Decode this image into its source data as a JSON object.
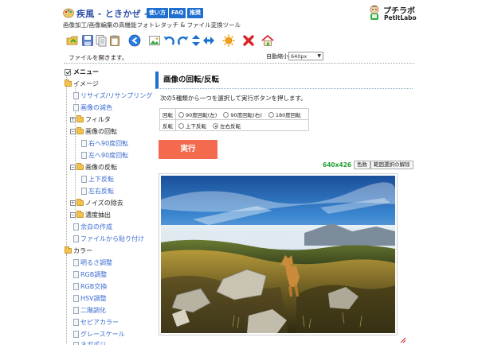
{
  "header": {
    "app_title": "疾風 - ときかぜ -",
    "subtitle": "画像加工/画像編集の高機能フォトレタッチ & ファイル変換ツール",
    "nav": [
      {
        "label": "使い方"
      },
      {
        "label": "FAQ"
      },
      {
        "label": "推奨"
      }
    ],
    "brand_jp": "プチラボ",
    "brand_en": "PetitLabo"
  },
  "toolbar": {
    "icons": [
      "open-icon",
      "save-icon",
      "copy-icon",
      "paste-icon",
      "back-icon",
      "image-icon",
      "undo-icon",
      "redo-icon",
      "swap-vertical-icon",
      "swap-horizontal-icon",
      "settings-sun-icon",
      "clear-icon",
      "home-icon"
    ]
  },
  "status": {
    "text": "ファイルを開きます。",
    "zoom_label": "自動縮小",
    "zoom_value": "640px"
  },
  "sidebar": {
    "root": "メニュー",
    "items": [
      {
        "label": "イメージ",
        "kind": "folder-open"
      },
      {
        "label": "リサイズ/リサンプリング",
        "kind": "leaf"
      },
      {
        "label": "画像の減色",
        "kind": "leaf"
      },
      {
        "label": "フィルタ",
        "kind": "folder-closed"
      },
      {
        "label": "画像の回転",
        "kind": "folder-open"
      },
      {
        "label": "右へ90度回転",
        "kind": "leaf"
      },
      {
        "label": "左へ90度回転",
        "kind": "leaf"
      },
      {
        "label": "画像の反転",
        "kind": "folder-open"
      },
      {
        "label": "上下反転",
        "kind": "leaf"
      },
      {
        "label": "左右反転",
        "kind": "leaf"
      },
      {
        "label": "ノイズの除去",
        "kind": "folder-closed"
      },
      {
        "label": "濃度抽出",
        "kind": "folder-open"
      },
      {
        "label": "余白の作成",
        "kind": "leaf"
      },
      {
        "label": "ファイルから貼り付け",
        "kind": "leaf"
      },
      {
        "label": "カラー",
        "kind": "folder-open"
      },
      {
        "label": "明るさ調整",
        "kind": "leaf"
      },
      {
        "label": "RGB調整",
        "kind": "leaf"
      },
      {
        "label": "RGB交換",
        "kind": "leaf"
      },
      {
        "label": "HSV調整",
        "kind": "leaf"
      },
      {
        "label": "二階調化",
        "kind": "leaf"
      },
      {
        "label": "セピアカラー",
        "kind": "leaf"
      },
      {
        "label": "グレースケール",
        "kind": "leaf"
      },
      {
        "label": "ネガポジ",
        "kind": "leaf"
      }
    ]
  },
  "main": {
    "title": "画像の回転/反転",
    "instruction": "次の5種類から一つを選択して実行ボタンを押します。",
    "rotate_label": "回転",
    "rotate_options": [
      "90度回転(左)",
      "90度回転(右)",
      "180度回転"
    ],
    "flip_label": "反転",
    "flip_options": [
      "上下反転",
      "左右反転"
    ],
    "selected_flip": "左右反転",
    "run_label": "実行",
    "image_size": "640x426",
    "color_button": "色数",
    "clear_selection_button": "範囲選択の解除"
  },
  "colors": {
    "accent": "#1e6fd0",
    "run_button": "#f36a4f",
    "link": "#3a6ad0",
    "size_text": "#22a030"
  }
}
